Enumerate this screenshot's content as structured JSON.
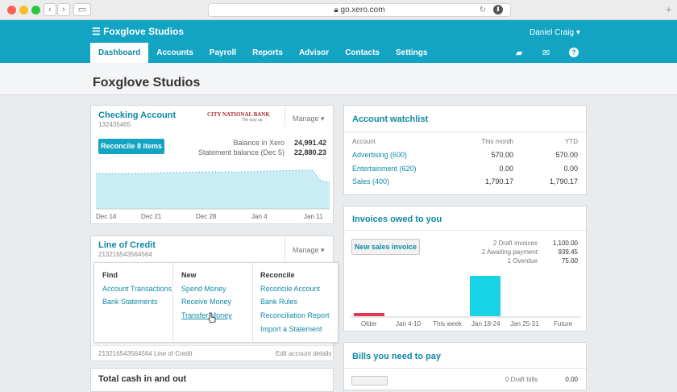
{
  "browser": {
    "url": "go.xero.com",
    "lock_icon": "lock-icon"
  },
  "header": {
    "org_name": "Foxglove Studios",
    "user": "Daniel Craig",
    "nav": [
      "Dashboard",
      "Accounts",
      "Payroll",
      "Reports",
      "Advisor",
      "Contacts",
      "Settings"
    ]
  },
  "page": {
    "title": "Foxglove Studios"
  },
  "checking": {
    "title": "Checking Account",
    "number": "132435465",
    "bank_logo_text": "CITY NATIONAL BANK",
    "bank_tagline": "The way up.",
    "manage": "Manage",
    "reconcile_button": "Reconcile 8 items",
    "balance_xero_label": "Balance in Xero",
    "balance_xero": "24,991.42",
    "statement_label": "Statement balance (Dec 5)",
    "statement": "22,880.23",
    "x_labels": [
      "Dec 14",
      "Dec 21",
      "Dec 28",
      "Jan 4",
      "Jan 11"
    ]
  },
  "loc": {
    "title": "Line of Credit",
    "number": "213216543564564",
    "manage": "Manage",
    "menu": {
      "find_header": "Find",
      "find": [
        "Account Transactions",
        "Bank Statements"
      ],
      "new_header": "New",
      "new": [
        "Spend Money",
        "Receive Money",
        "Transfer Money"
      ],
      "reconcile_header": "Reconcile",
      "reconcile": [
        "Reconcile Account",
        "Bank Rules",
        "Reconciliation Report",
        "Import a Statement"
      ]
    },
    "footer_left": "213216543564564 Line of Credit",
    "footer_right": "Edit account details"
  },
  "cash": {
    "title": "Total cash in and out"
  },
  "watchlist": {
    "title": "Account watchlist",
    "headers": [
      "Account",
      "This month",
      "YTD"
    ],
    "rows": [
      {
        "account": "Advertising (600)",
        "month": "570.00",
        "ytd": "570.00"
      },
      {
        "account": "Entertainment (620)",
        "month": "0.00",
        "ytd": "0.00"
      },
      {
        "account": "Sales (400)",
        "month": "1,790.17",
        "ytd": "1,790.17"
      }
    ]
  },
  "invoices": {
    "title": "Invoices owed to you",
    "button": "New sales invoice",
    "summary": [
      {
        "label": "2 Draft invoices",
        "value": "1,100.00"
      },
      {
        "label": "2 Awaiting payment",
        "value": "939.45"
      },
      {
        "label": "1 Overdue",
        "value": "75.00"
      }
    ],
    "bars": [
      "Older",
      "Jan 4-10",
      "This week",
      "Jan 18-24",
      "Jan 25-31",
      "Future"
    ]
  },
  "bills": {
    "title": "Bills you need to pay",
    "draft_label": "0 Draft bills",
    "draft_value": "0.00"
  },
  "colors": {
    "brand": "#13a4c4",
    "link": "#0f8aa7",
    "overdue": "#e0394f",
    "bar": "#18d2e8",
    "chart_fill": "#c9ecf5"
  }
}
